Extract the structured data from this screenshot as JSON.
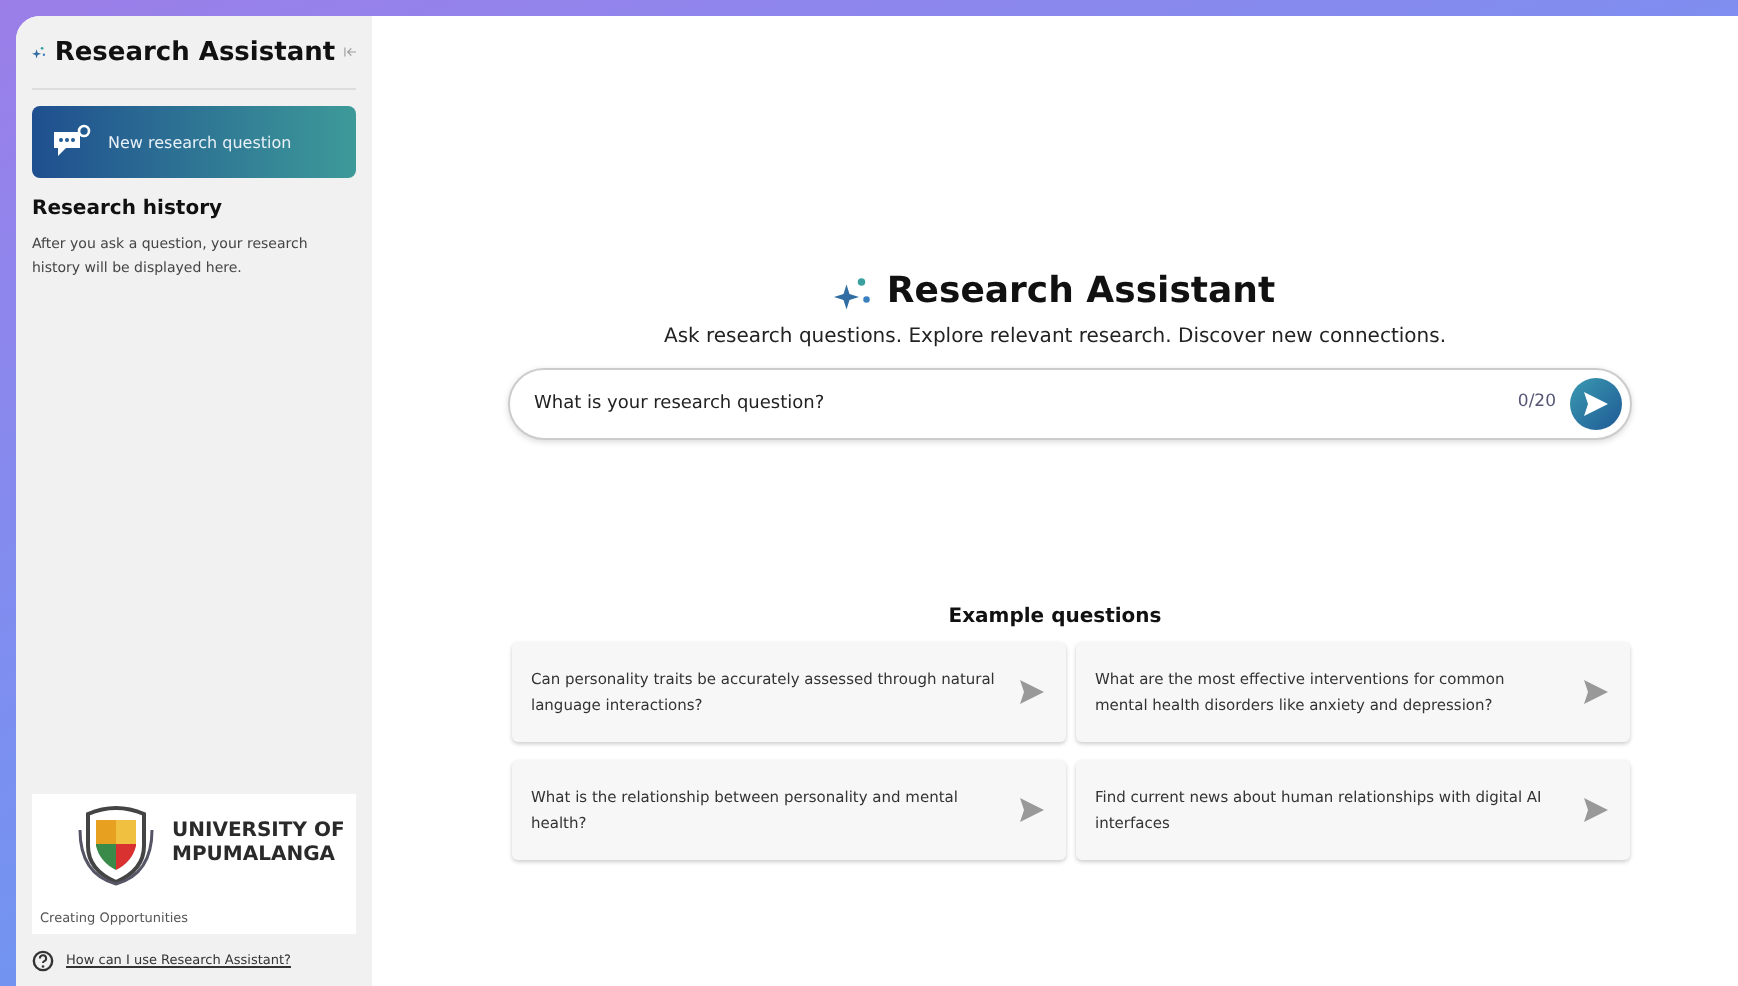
{
  "sidebar": {
    "title": "Research Assistant",
    "new_button": "New research question",
    "history_heading": "Research history",
    "history_note": "After you ask a question, your research history will be displayed here.",
    "logo": {
      "name_line_1": "UNIVERSITY OF",
      "name_line_2": "MPUMALANGA",
      "tagline": "Creating Opportunities"
    },
    "help_link": "How can I use Research Assistant?"
  },
  "main": {
    "title": "Research Assistant",
    "subtitle": "Ask research questions. Explore relevant research. Discover new connections.",
    "search": {
      "placeholder": "What is your research question?",
      "counter": "0/20"
    },
    "examples_heading": "Example questions",
    "examples": [
      {
        "text": "Can personality traits be accurately assessed through natural language interactions?"
      },
      {
        "text": "What are the most effective interventions for common mental health disorders like anxiety and depression?"
      },
      {
        "text": "What is the relationship between personality and mental health?"
      },
      {
        "text": "Find current news about human relationships with digital AI interfaces"
      }
    ]
  }
}
